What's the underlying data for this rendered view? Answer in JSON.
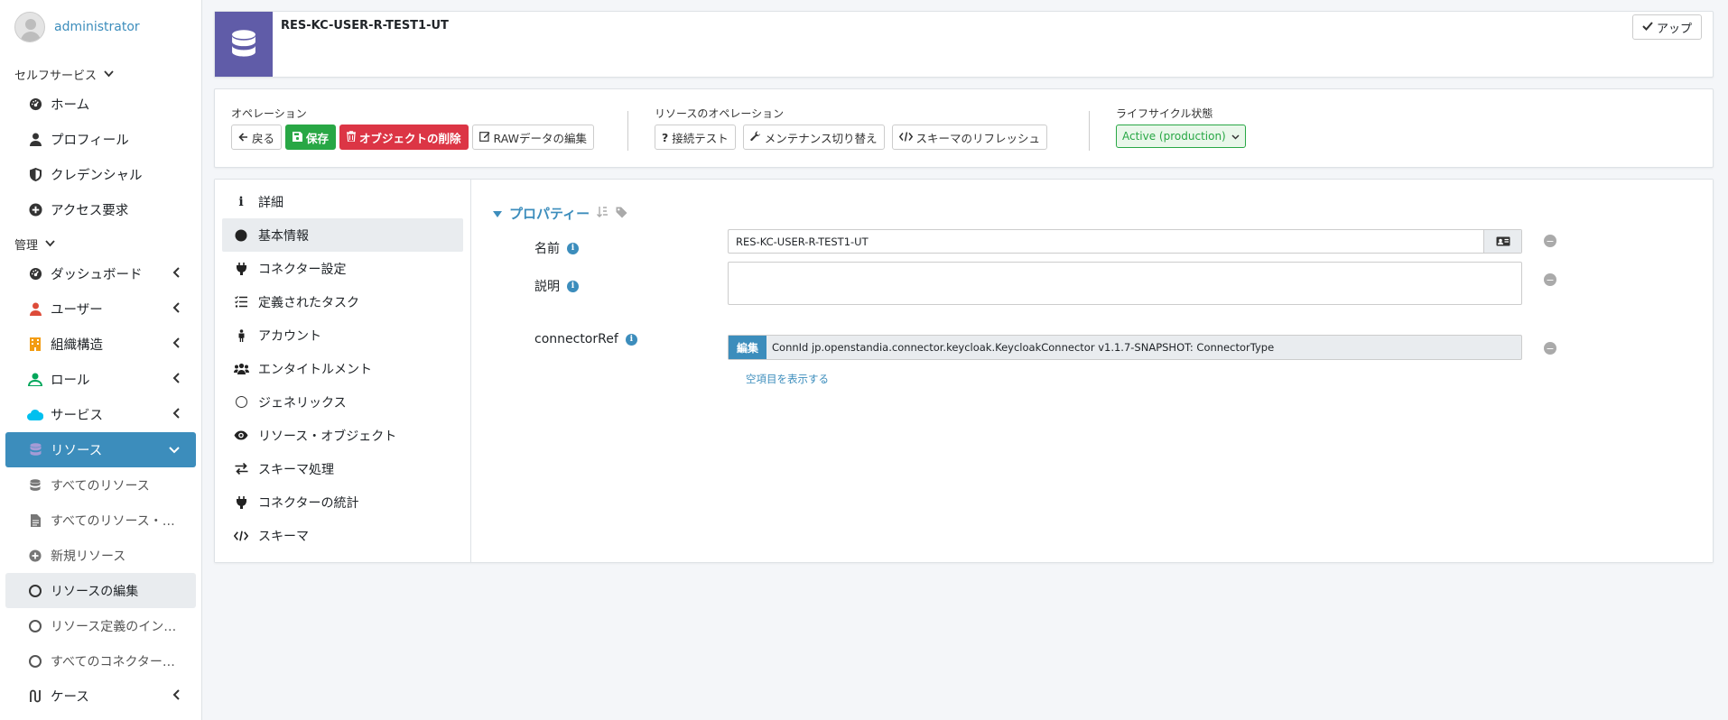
{
  "user": {
    "name": "administrator"
  },
  "sidebar": {
    "self_service_header": "セルフサービス",
    "self_service_items": [
      {
        "label": "ホーム",
        "icon": "dashboard-icon"
      },
      {
        "label": "プロフィール",
        "icon": "user-icon"
      },
      {
        "label": "クレデンシャル",
        "icon": "shield-icon"
      },
      {
        "label": "アクセス要求",
        "icon": "plus-circle-icon"
      }
    ],
    "admin_header": "管理",
    "admin_items": [
      {
        "label": "ダッシュボード",
        "icon": "dashboard-icon",
        "color": "#333333"
      },
      {
        "label": "ユーザー",
        "icon": "user-icon",
        "color": "#dd4b39"
      },
      {
        "label": "組織構造",
        "icon": "building-icon",
        "color": "#f39c12"
      },
      {
        "label": "ロール",
        "icon": "user-tag-icon",
        "color": "#00a65a"
      },
      {
        "label": "サービス",
        "icon": "cloud-icon",
        "color": "#00c0ef"
      }
    ],
    "resources": {
      "label": "リソース",
      "sub_items": [
        {
          "label": "すべてのリソース",
          "icon": "database-icon"
        },
        {
          "label": "すべてのリソース・…",
          "icon": "file-icon"
        },
        {
          "label": "新規リソース",
          "icon": "plus-circle-icon"
        },
        {
          "label": "リソースの編集",
          "icon": "circle-icon"
        },
        {
          "label": "リソース定義のイン…",
          "icon": "circle-icon"
        },
        {
          "label": "すべてのコネクター…",
          "icon": "circle-icon"
        }
      ]
    },
    "cases_label": "ケース"
  },
  "header": {
    "resource_name": "RES-KC-USER-R-TEST1-UT",
    "up_button": "アップ",
    "icon_color": "#605ca8"
  },
  "operations": {
    "label": "オペレーション",
    "back": "戻る",
    "save": "保存",
    "delete": "オブジェクトの削除",
    "edit_raw": "RAWデータの編集"
  },
  "resource_operations": {
    "label": "リソースのオペレーション",
    "test_connection": "接続テスト",
    "maintenance": "メンテナンス切り替え",
    "refresh_schema": "スキーマのリフレッシュ"
  },
  "lifecycle": {
    "label": "ライフサイクル状態",
    "value": "Active (production)"
  },
  "tabs": [
    {
      "label": "詳細",
      "icon": "info-icon"
    },
    {
      "label": "基本情報",
      "icon": "circle-filled-icon"
    },
    {
      "label": "コネクター設定",
      "icon": "plug-icon"
    },
    {
      "label": "定義されたタスク",
      "icon": "tasks-icon"
    },
    {
      "label": "アカウント",
      "icon": "person-icon"
    },
    {
      "label": "エンタイトルメント",
      "icon": "users-icon"
    },
    {
      "label": "ジェネリックス",
      "icon": "circle-icon"
    },
    {
      "label": "リソース・オブジェクト",
      "icon": "eye-icon"
    },
    {
      "label": "スキーマ処理",
      "icon": "exchange-icon"
    },
    {
      "label": "コネクターの統計",
      "icon": "plug-icon"
    },
    {
      "label": "スキーマ",
      "icon": "code-icon"
    }
  ],
  "properties": {
    "title": "プロパティー",
    "name_label": "名前",
    "name_value": "RES-KC-USER-R-TEST1-UT",
    "description_label": "説明",
    "description_value": "",
    "connector_ref_label": "connectorRef",
    "edit_label": "編集",
    "connector_ref_value": "ConnId jp.openstandia.connector.keycloak.KeycloakConnector v1.1.7-SNAPSHOT: ConnectorType",
    "show_empty": "空項目を表示する"
  }
}
